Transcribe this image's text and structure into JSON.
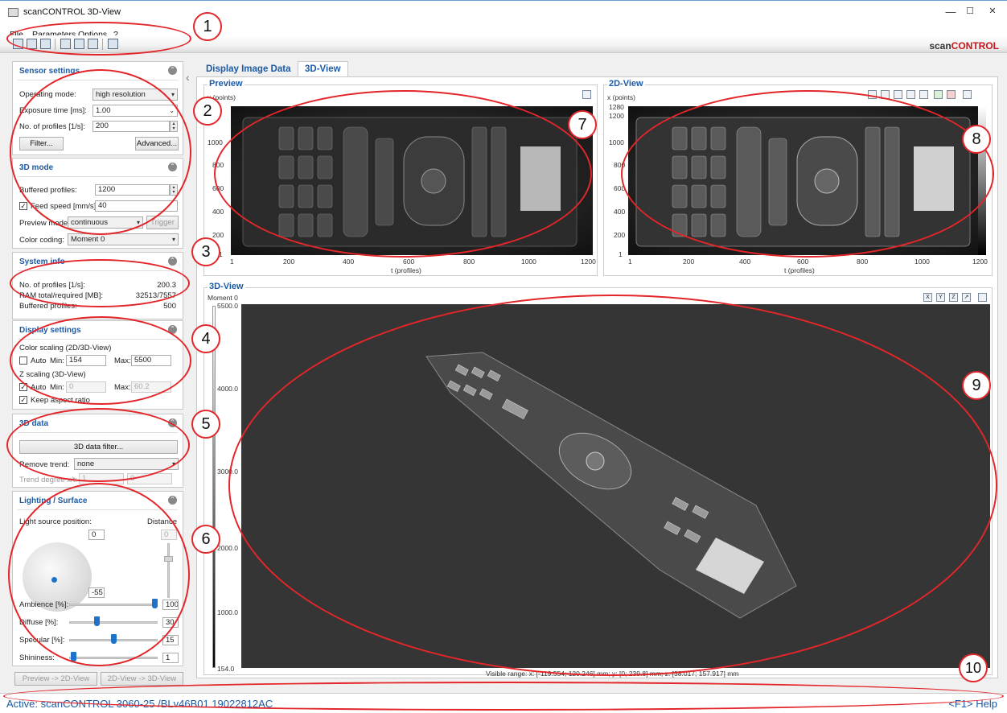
{
  "window": {
    "title": "scanCONTROL 3D-View",
    "min": "—",
    "max": "☐",
    "close": "✕"
  },
  "menu": [
    "File",
    "Parameters",
    "Options",
    "?"
  ],
  "brand": {
    "part1": "scan",
    "part2": "CONTROL"
  },
  "sensor": {
    "title": "Sensor settings",
    "operating_mode_label": "Operating mode:",
    "operating_mode": "high resolution",
    "exposure_label": "Exposure time [ms]:",
    "exposure": "1.00",
    "profiles_label": "No. of profiles [1/s]:",
    "profiles": "200",
    "filter_btn": "Filter...",
    "advanced_btn": "Advanced..."
  },
  "mode3d": {
    "title": "3D mode",
    "buffered_label": "Buffered profiles:",
    "buffered": "1200",
    "feed_label": "Feed speed [mm/s]:",
    "feed": "40",
    "preview_label": "Preview mode:",
    "preview": "continuous",
    "trigger_btn": "Trigger",
    "color_label": "Color coding:",
    "color": "Moment 0"
  },
  "sysinfo": {
    "title": "System info",
    "profiles_label": "No. of profiles [1/s]:",
    "profiles": "200.3",
    "ram_label": "RAM total/required [MB]:",
    "ram": "32513/7557",
    "buffered_label": "Buffered profiles:",
    "buffered": "500"
  },
  "display": {
    "title": "Display settings",
    "color_scaling": "Color scaling (2D/3D-View)",
    "auto": "Auto",
    "min": "Min:",
    "max": "Max:",
    "cmin": "154",
    "cmax": "5500",
    "z_scaling": "Z scaling (3D-View)",
    "zmin": "0",
    "zmax": "60.2",
    "keep_aspect": "Keep aspect ratio"
  },
  "data3d": {
    "title": "3D data",
    "filter_btn": "3D data filter...",
    "trend_label": "Remove trend:",
    "trend": "none",
    "degree_label": "Trend degree x/t:",
    "deg_x": "1",
    "deg_t": "0"
  },
  "lighting": {
    "title": "Lighting / Surface",
    "light_pos": "Light source position:",
    "distance": "Distance",
    "pos_x": "0",
    "pos_y": "-55",
    "dist": "0",
    "ambience_label": "Ambience [%]:",
    "ambience": "100",
    "ambience_frac": 1.0,
    "diffuse_label": "Diffuse [%]:",
    "diffuse": "30",
    "diffuse_frac": 0.3,
    "specular_label": "Specular [%]:",
    "specular": "15",
    "specular_frac": 0.5,
    "shininess_label": "Shininess:",
    "shininess": "1",
    "shininess_frac": 0.02
  },
  "buttons": {
    "preview_to_2d": "Preview -> 2D-View",
    "twod_to_3d": "2D-View -> 3D-View"
  },
  "tabs": [
    {
      "label": "Display Image Data"
    },
    {
      "label": "3D-View"
    }
  ],
  "preview": {
    "title": "Preview",
    "ylabel": "x (points)",
    "xlabel": "t (profiles)",
    "yticks": [
      "1000",
      "800",
      "600",
      "400",
      "200",
      "1"
    ],
    "xticks": [
      "1",
      "200",
      "400",
      "600",
      "800",
      "1000",
      "1200"
    ]
  },
  "view2d": {
    "title": "2D-View",
    "ylabel": "x (points)",
    "xlabel": "t (profiles)",
    "yticks": [
      "1280",
      "1200",
      "1000",
      "800",
      "600",
      "400",
      "200",
      "1"
    ],
    "xticks": [
      "1",
      "200",
      "400",
      "600",
      "800",
      "1000",
      "1200"
    ]
  },
  "view3d": {
    "title": "3D-View",
    "subtitle": "Moment 0",
    "scale": [
      "5500.0",
      "4000.0",
      "3000.0",
      "2000.0",
      "1000.0",
      "154.0"
    ],
    "axis_buttons": [
      "X",
      "Y",
      "Z",
      "↗"
    ],
    "visible_range": "Visible range:   x: [-119.554; 120.246] mm; y: [0; 239.8] mm; z: [38.017; 157.917] mm"
  },
  "status": {
    "active": "Active: scanCONTROL 3060-25 /BLv46B01  19022812AC",
    "help": "<F1> Help"
  },
  "annotations": [
    "1",
    "2",
    "3",
    "4",
    "5",
    "6",
    "7",
    "8",
    "9",
    "10"
  ]
}
